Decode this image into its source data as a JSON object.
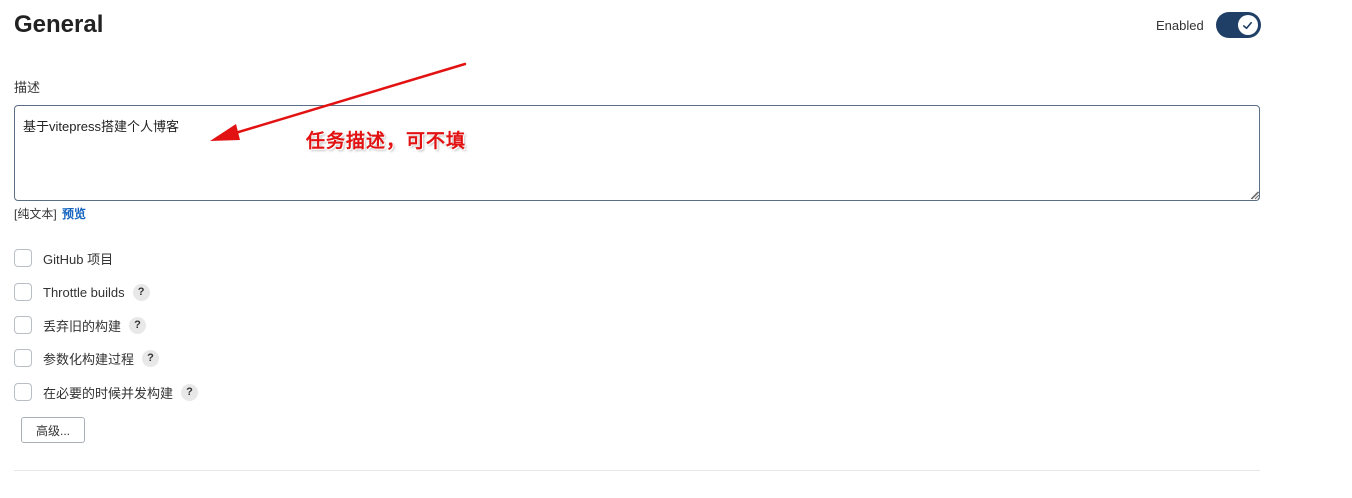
{
  "section": {
    "title": "General"
  },
  "enabled": {
    "label": "Enabled",
    "state": true,
    "accent_color": "#1f3f66",
    "icon": "check-icon"
  },
  "description": {
    "label": "描述",
    "value": "基于vitepress搭建个人博客",
    "format_label": "[纯文本]",
    "preview_label": "预览"
  },
  "options": [
    {
      "label": "GitHub 项目",
      "checked": false,
      "has_help": false
    },
    {
      "label": "Throttle builds",
      "checked": false,
      "has_help": true
    },
    {
      "label": "丢弃旧的构建",
      "checked": false,
      "has_help": true
    },
    {
      "label": "参数化构建过程",
      "checked": false,
      "has_help": true
    },
    {
      "label": "在必要的时候并发构建",
      "checked": false,
      "has_help": true
    }
  ],
  "help_glyph": "?",
  "advanced_button": {
    "label": "高级..."
  },
  "annotation": {
    "text": "任务描述，可不填",
    "color": "#e31212"
  }
}
